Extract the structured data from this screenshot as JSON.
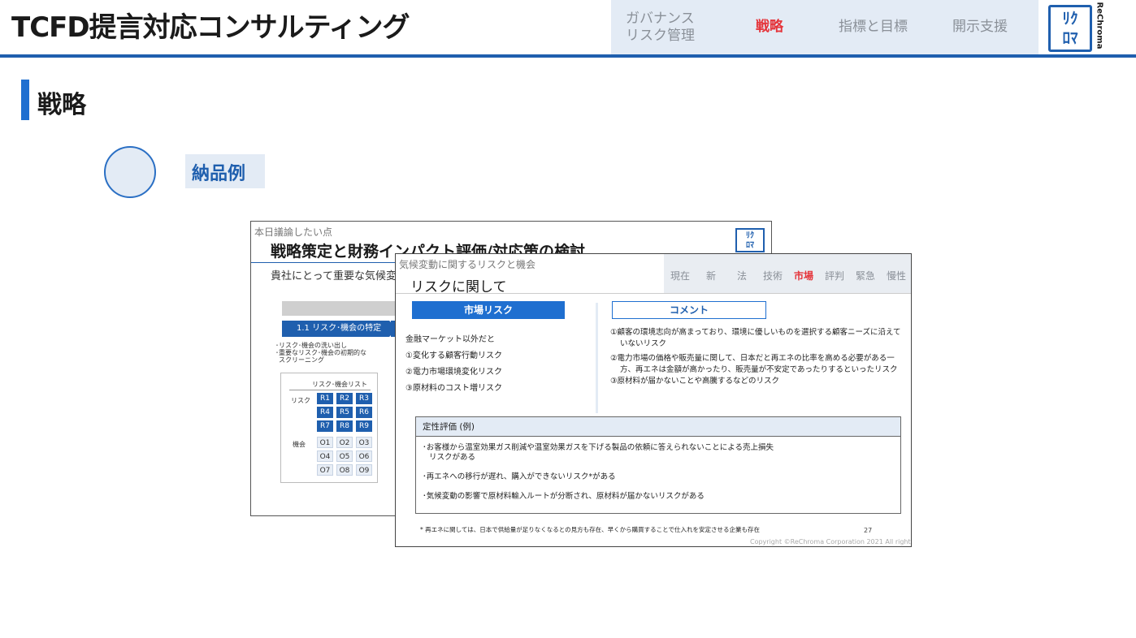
{
  "header": {
    "title": "TCFD提言対応コンサルティング",
    "nav": [
      {
        "label": "ガバナンス\nリスク管理",
        "line1": "ガバナンス",
        "line2": "リスク管理",
        "active": false
      },
      {
        "label": "戦略",
        "active": true
      },
      {
        "label": "指標と目標",
        "active": false
      },
      {
        "label": "開示支援",
        "active": false
      }
    ],
    "logo": {
      "line1": "ﾘｸ",
      "line2": "ﾛﾏ",
      "side": "ReChroma"
    }
  },
  "section": {
    "title": "戦略"
  },
  "deliverable": {
    "label": "納品例"
  },
  "slide_back": {
    "kicker": "本日議論したい点",
    "title": "戦略策定と財務インパクト評価/対応策の検討",
    "subtitle": "貴社にとって重要な気候変動",
    "step": "1.1 リスク･機会の特定",
    "bullets": [
      "･リスク･機会の洗い出し",
      "･重要なリスク･機会の初期的な",
      "スクリーニング"
    ],
    "list_title": "リスク･機会リスト",
    "risk_label": "リスク",
    "opp_label": "機会",
    "risks": [
      "R1",
      "R2",
      "R3",
      "R4",
      "R5",
      "R6",
      "R7",
      "R8",
      "R9"
    ],
    "opps": [
      "O1",
      "O2",
      "O3",
      "O4",
      "O5",
      "O6",
      "O7",
      "O8",
      "O9"
    ]
  },
  "slide_front": {
    "kicker": "気候変動に関するリスクと機会",
    "title": "リスクに関して",
    "tabs": [
      {
        "label": "現在",
        "active": false
      },
      {
        "label": "新",
        "active": false
      },
      {
        "label": "法",
        "active": false
      },
      {
        "label": "技術",
        "active": false
      },
      {
        "label": "市場",
        "active": true
      },
      {
        "label": "評判",
        "active": false
      },
      {
        "label": "緊急",
        "active": false
      },
      {
        "label": "慢性",
        "active": false
      }
    ],
    "market_head": "市場リスク",
    "comment_head": "コメント",
    "market_lines": [
      "金融マーケット以外だと",
      "①変化する顧客行動リスク",
      "②電力市場環境変化リスク",
      "③原材料のコスト増リスク"
    ],
    "comment_lines": [
      "①顧客の環境志向が高まっており、環境に優しいものを選択する顧客ニーズに沿えて",
      "いないリスク",
      "②電力市場の価格や販売量に関して、日本だと再エネの比率を高める必要がある一",
      "方、再エネは金額が高かったり、販売量が不安定であったりするといったリスク",
      "③原材料が届かないことや高騰するなどのリスク"
    ],
    "eval_head": "定性評価 (例)",
    "eval_lines": [
      "･お客様から温室効果ガス削減や温室効果ガスを下げる製品の依頼に答えられないことによる売上損失",
      "リスクがある",
      "･再エネへの移行が遅れ、購入ができないリスク*がある",
      "･気候変動の影響で原材料輸入ルートが分断され、原材料が届かないリスクがある"
    ],
    "footnote": "* 再エネに関しては、日本で供給量が足りなくなるとの見方も存在、早くから購買することで仕入れを安定させる企業も存在",
    "page": "27",
    "copyright": "Copyright ©ReChroma Corporation 2021 All right"
  }
}
